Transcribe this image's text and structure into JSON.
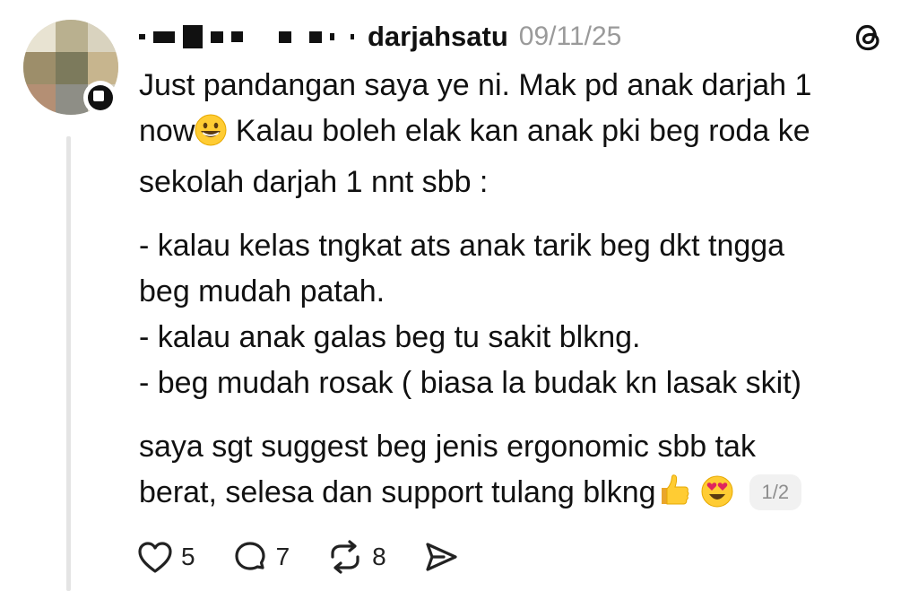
{
  "post": {
    "username": "darjahsatu",
    "timestamp": "09/11/25",
    "paragraph1": {
      "line1": "Just pandangan saya ye ni. Mak pd anak darjah 1",
      "line2_a": "now",
      "line2_b": " Kalau boleh elak kan anak pki beg roda ke",
      "line3": "sekolah darjah 1 nnt sbb :"
    },
    "paragraph2": {
      "line1": "- kalau kelas tngkat ats anak tarik beg dkt tngga",
      "line2": "beg mudah patah.",
      "line3": "- kalau anak galas beg tu sakit blkng.",
      "line4": "- beg mudah rosak ( biasa la budak kn lasak skit)"
    },
    "paragraph3": {
      "line1": "saya sgt suggest beg jenis ergonomic sbb tak",
      "line2": "berat, selesa dan support tulang blkng"
    },
    "page_indicator": "1/2",
    "emojis": [
      "grinning-face-emoji",
      "thumbs-up-emoji",
      "heart-eyes-emoji"
    ]
  },
  "actions": {
    "likes": "5",
    "replies": "7",
    "reposts": "8"
  },
  "icons": [
    "threads-logo-icon",
    "heart-icon",
    "comment-icon",
    "repost-icon",
    "share-icon"
  ],
  "colors": {
    "text": "#111111",
    "muted": "#9a9a9a",
    "thread_line": "#e4e4e4",
    "badge_bg": "#f1f1f1"
  }
}
